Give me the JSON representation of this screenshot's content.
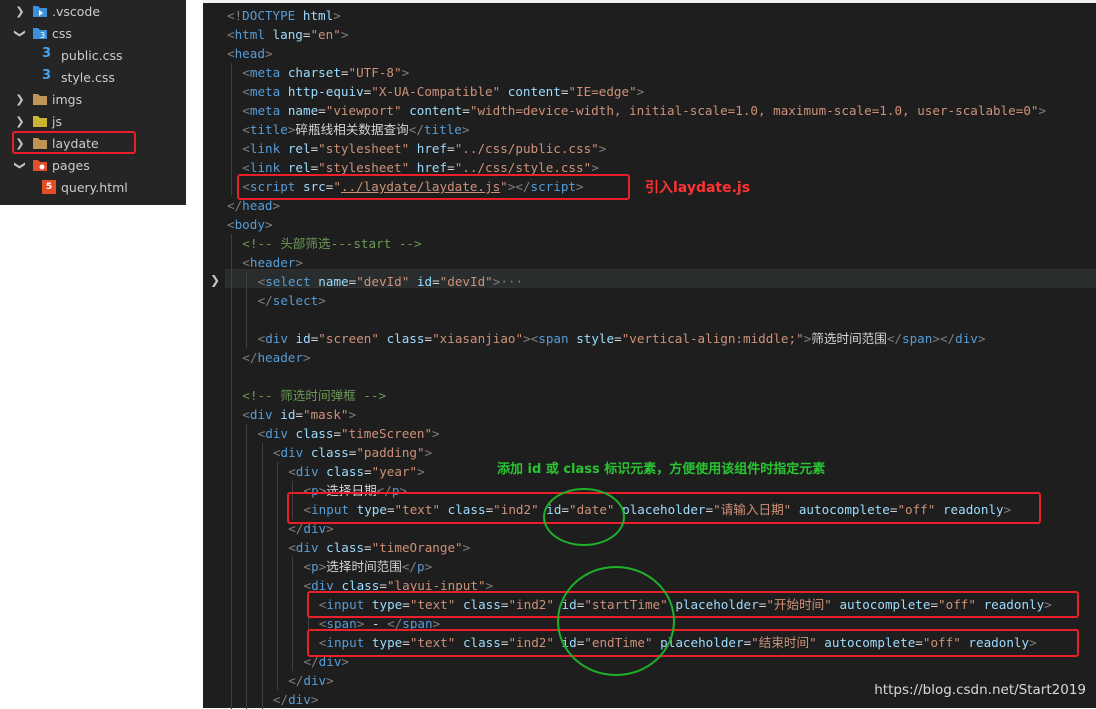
{
  "explorer": {
    "items": [
      {
        "label": ".vscode",
        "expanded": false,
        "icon": "vscode-folder-icon"
      },
      {
        "label": "css",
        "expanded": true,
        "icon": "css-folder-icon"
      },
      {
        "label": "public.css",
        "icon": "css-file-icon"
      },
      {
        "label": "style.css",
        "icon": "css-file-icon"
      },
      {
        "label": "imgs",
        "expanded": false,
        "icon": "folder-icon"
      },
      {
        "label": "js",
        "expanded": false,
        "icon": "js-folder-icon"
      },
      {
        "label": "laydate",
        "expanded": false,
        "icon": "folder-icon",
        "highlighted": true
      },
      {
        "label": "pages",
        "expanded": true,
        "icon": "pages-folder-icon"
      },
      {
        "label": "query.html",
        "icon": "html-file-icon"
      }
    ]
  },
  "code_lines": [
    {
      "indent": 0,
      "tokens": [
        [
          "brk",
          "<!"
        ],
        [
          "tag",
          "DOCTYPE"
        ],
        [
          "txt",
          " "
        ],
        [
          "attr",
          "html"
        ],
        [
          "brk",
          ">"
        ]
      ]
    },
    {
      "indent": 0,
      "tokens": [
        [
          "brk",
          "<"
        ],
        [
          "tag",
          "html"
        ],
        [
          "txt",
          " "
        ],
        [
          "attr",
          "lang"
        ],
        [
          "txt",
          "="
        ],
        [
          "str",
          "\"en\""
        ],
        [
          "brk",
          ">"
        ]
      ]
    },
    {
      "indent": 0,
      "tokens": [
        [
          "brk",
          "<"
        ],
        [
          "tag",
          "head"
        ],
        [
          "brk",
          ">"
        ]
      ]
    },
    {
      "indent": 1,
      "tokens": [
        [
          "brk",
          "<"
        ],
        [
          "tag",
          "meta"
        ],
        [
          "txt",
          " "
        ],
        [
          "attr",
          "charset"
        ],
        [
          "txt",
          "="
        ],
        [
          "str",
          "\"UTF-8\""
        ],
        [
          "brk",
          ">"
        ]
      ]
    },
    {
      "indent": 1,
      "tokens": [
        [
          "brk",
          "<"
        ],
        [
          "tag",
          "meta"
        ],
        [
          "txt",
          " "
        ],
        [
          "attr",
          "http-equiv"
        ],
        [
          "txt",
          "="
        ],
        [
          "str",
          "\"X-UA-Compatible\""
        ],
        [
          "txt",
          " "
        ],
        [
          "attr",
          "content"
        ],
        [
          "txt",
          "="
        ],
        [
          "str",
          "\"IE=edge\""
        ],
        [
          "brk",
          ">"
        ]
      ]
    },
    {
      "indent": 1,
      "tokens": [
        [
          "brk",
          "<"
        ],
        [
          "tag",
          "meta"
        ],
        [
          "txt",
          " "
        ],
        [
          "attr",
          "name"
        ],
        [
          "txt",
          "="
        ],
        [
          "str",
          "\"viewport\""
        ],
        [
          "txt",
          " "
        ],
        [
          "attr",
          "content"
        ],
        [
          "txt",
          "="
        ],
        [
          "str",
          "\"width=device-width, initial-scale=1.0, maximum-scale=1.0, user-scalable=0\""
        ],
        [
          "brk",
          ">"
        ]
      ]
    },
    {
      "indent": 1,
      "tokens": [
        [
          "brk",
          "<"
        ],
        [
          "tag",
          "title"
        ],
        [
          "brk",
          ">"
        ],
        [
          "txt",
          "碎瓶线相关数据查询"
        ],
        [
          "brk",
          "</"
        ],
        [
          "tag",
          "title"
        ],
        [
          "brk",
          ">"
        ]
      ]
    },
    {
      "indent": 1,
      "tokens": [
        [
          "brk",
          "<"
        ],
        [
          "tag",
          "link"
        ],
        [
          "txt",
          " "
        ],
        [
          "attr",
          "rel"
        ],
        [
          "txt",
          "="
        ],
        [
          "str",
          "\"stylesheet\""
        ],
        [
          "txt",
          " "
        ],
        [
          "attr",
          "href"
        ],
        [
          "txt",
          "="
        ],
        [
          "str",
          "\"../css/public.css\""
        ],
        [
          "brk",
          ">"
        ]
      ]
    },
    {
      "indent": 1,
      "tokens": [
        [
          "brk",
          "<"
        ],
        [
          "tag",
          "link"
        ],
        [
          "txt",
          " "
        ],
        [
          "attr",
          "rel"
        ],
        [
          "txt",
          "="
        ],
        [
          "str",
          "\"stylesheet\""
        ],
        [
          "txt",
          " "
        ],
        [
          "attr",
          "href"
        ],
        [
          "txt",
          "="
        ],
        [
          "str",
          "\"../css/style.css\""
        ],
        [
          "brk",
          ">"
        ]
      ]
    },
    {
      "indent": 1,
      "tokens": [
        [
          "brk",
          "<"
        ],
        [
          "tag",
          "script"
        ],
        [
          "txt",
          " "
        ],
        [
          "attr",
          "src"
        ],
        [
          "txt",
          "="
        ],
        [
          "str",
          "\""
        ],
        [
          "link",
          "../laydate/laydate.js"
        ],
        [
          "str",
          "\""
        ],
        [
          "brk",
          "></"
        ],
        [
          "tag",
          "script"
        ],
        [
          "brk",
          ">"
        ]
      ]
    },
    {
      "indent": 0,
      "tokens": [
        [
          "brk",
          "</"
        ],
        [
          "tag",
          "head"
        ],
        [
          "brk",
          ">"
        ]
      ]
    },
    {
      "indent": 0,
      "tokens": [
        [
          "brk",
          "<"
        ],
        [
          "tag",
          "body"
        ],
        [
          "brk",
          ">"
        ]
      ]
    },
    {
      "indent": 1,
      "tokens": [
        [
          "cmt",
          "<!-- 头部筛选---start -->"
        ]
      ]
    },
    {
      "indent": 1,
      "tokens": [
        [
          "brk",
          "<"
        ],
        [
          "tag",
          "header"
        ],
        [
          "brk",
          ">"
        ]
      ]
    },
    {
      "indent": 2,
      "tokens": [
        [
          "brk",
          "<"
        ],
        [
          "tag",
          "select"
        ],
        [
          "txt",
          " "
        ],
        [
          "attr",
          "name"
        ],
        [
          "txt",
          "="
        ],
        [
          "str",
          "\"devId\""
        ],
        [
          "txt",
          " "
        ],
        [
          "attr",
          "id"
        ],
        [
          "txt",
          "="
        ],
        [
          "str",
          "\"devId\""
        ],
        [
          "brk",
          ">"
        ],
        [
          "brk",
          "···"
        ]
      ],
      "folded": true
    },
    {
      "indent": 2,
      "tokens": [
        [
          "brk",
          "</"
        ],
        [
          "tag",
          "select"
        ],
        [
          "brk",
          ">"
        ]
      ]
    },
    {
      "indent": 0,
      "tokens": []
    },
    {
      "indent": 2,
      "tokens": [
        [
          "brk",
          "<"
        ],
        [
          "tag",
          "div"
        ],
        [
          "txt",
          " "
        ],
        [
          "attr",
          "id"
        ],
        [
          "txt",
          "="
        ],
        [
          "str",
          "\"screen\""
        ],
        [
          "txt",
          " "
        ],
        [
          "attr",
          "class"
        ],
        [
          "txt",
          "="
        ],
        [
          "str",
          "\"xiasanjiao\""
        ],
        [
          "brk",
          "><"
        ],
        [
          "tag",
          "span"
        ],
        [
          "txt",
          " "
        ],
        [
          "attr",
          "style"
        ],
        [
          "txt",
          "="
        ],
        [
          "str",
          "\"vertical-align:middle;\""
        ],
        [
          "brk",
          ">"
        ],
        [
          "txt",
          "筛选时间范围"
        ],
        [
          "brk",
          "</"
        ],
        [
          "tag",
          "span"
        ],
        [
          "brk",
          "></"
        ],
        [
          "tag",
          "div"
        ],
        [
          "brk",
          ">"
        ]
      ]
    },
    {
      "indent": 1,
      "tokens": [
        [
          "brk",
          "</"
        ],
        [
          "tag",
          "header"
        ],
        [
          "brk",
          ">"
        ]
      ]
    },
    {
      "indent": 0,
      "tokens": []
    },
    {
      "indent": 1,
      "tokens": [
        [
          "cmt",
          "<!-- 筛选时间弹框 -->"
        ]
      ]
    },
    {
      "indent": 1,
      "tokens": [
        [
          "brk",
          "<"
        ],
        [
          "tag",
          "div"
        ],
        [
          "txt",
          " "
        ],
        [
          "attr",
          "id"
        ],
        [
          "txt",
          "="
        ],
        [
          "str",
          "\"mask\""
        ],
        [
          "brk",
          ">"
        ]
      ]
    },
    {
      "indent": 2,
      "tokens": [
        [
          "brk",
          "<"
        ],
        [
          "tag",
          "div"
        ],
        [
          "txt",
          " "
        ],
        [
          "attr",
          "class"
        ],
        [
          "txt",
          "="
        ],
        [
          "str",
          "\"timeScreen\""
        ],
        [
          "brk",
          ">"
        ]
      ]
    },
    {
      "indent": 3,
      "tokens": [
        [
          "brk",
          "<"
        ],
        [
          "tag",
          "div"
        ],
        [
          "txt",
          " "
        ],
        [
          "attr",
          "class"
        ],
        [
          "txt",
          "="
        ],
        [
          "str",
          "\"padding\""
        ],
        [
          "brk",
          ">"
        ]
      ]
    },
    {
      "indent": 4,
      "tokens": [
        [
          "brk",
          "<"
        ],
        [
          "tag",
          "div"
        ],
        [
          "txt",
          " "
        ],
        [
          "attr",
          "class"
        ],
        [
          "txt",
          "="
        ],
        [
          "str",
          "\"year\""
        ],
        [
          "brk",
          ">"
        ]
      ]
    },
    {
      "indent": 5,
      "tokens": [
        [
          "brk",
          "<"
        ],
        [
          "tag",
          "p"
        ],
        [
          "brk",
          ">"
        ],
        [
          "txt",
          "选择日期"
        ],
        [
          "brk",
          "</"
        ],
        [
          "tag",
          "p"
        ],
        [
          "brk",
          ">"
        ]
      ]
    },
    {
      "indent": 5,
      "tokens": [
        [
          "brk",
          "<"
        ],
        [
          "tag",
          "input"
        ],
        [
          "txt",
          " "
        ],
        [
          "attr",
          "type"
        ],
        [
          "txt",
          "="
        ],
        [
          "str",
          "\"text\""
        ],
        [
          "txt",
          " "
        ],
        [
          "attr",
          "class"
        ],
        [
          "txt",
          "="
        ],
        [
          "str",
          "\"ind2\""
        ],
        [
          "txt",
          " "
        ],
        [
          "attr",
          "id"
        ],
        [
          "txt",
          "="
        ],
        [
          "str",
          "\"date\""
        ],
        [
          "txt",
          " "
        ],
        [
          "attr",
          "placeholder"
        ],
        [
          "txt",
          "="
        ],
        [
          "str",
          "\"请输入日期\""
        ],
        [
          "txt",
          " "
        ],
        [
          "attr",
          "autocomplete"
        ],
        [
          "txt",
          "="
        ],
        [
          "str",
          "\"off\""
        ],
        [
          "txt",
          " "
        ],
        [
          "attr",
          "readonly"
        ],
        [
          "brk",
          ">"
        ]
      ]
    },
    {
      "indent": 4,
      "tokens": [
        [
          "brk",
          "</"
        ],
        [
          "tag",
          "div"
        ],
        [
          "brk",
          ">"
        ]
      ]
    },
    {
      "indent": 4,
      "tokens": [
        [
          "brk",
          "<"
        ],
        [
          "tag",
          "div"
        ],
        [
          "txt",
          " "
        ],
        [
          "attr",
          "class"
        ],
        [
          "txt",
          "="
        ],
        [
          "str",
          "\"timeOrange\""
        ],
        [
          "brk",
          ">"
        ]
      ]
    },
    {
      "indent": 5,
      "tokens": [
        [
          "brk",
          "<"
        ],
        [
          "tag",
          "p"
        ],
        [
          "brk",
          ">"
        ],
        [
          "txt",
          "选择时间范围"
        ],
        [
          "brk",
          "</"
        ],
        [
          "tag",
          "p"
        ],
        [
          "brk",
          ">"
        ]
      ]
    },
    {
      "indent": 5,
      "tokens": [
        [
          "brk",
          "<"
        ],
        [
          "tag",
          "div"
        ],
        [
          "txt",
          " "
        ],
        [
          "attr",
          "class"
        ],
        [
          "txt",
          "="
        ],
        [
          "str",
          "\"layui-input\""
        ],
        [
          "brk",
          ">"
        ]
      ]
    },
    {
      "indent": 6,
      "tokens": [
        [
          "brk",
          "<"
        ],
        [
          "tag",
          "input"
        ],
        [
          "txt",
          " "
        ],
        [
          "attr",
          "type"
        ],
        [
          "txt",
          "="
        ],
        [
          "str",
          "\"text\""
        ],
        [
          "txt",
          " "
        ],
        [
          "attr",
          "class"
        ],
        [
          "txt",
          "="
        ],
        [
          "str",
          "\"ind2\""
        ],
        [
          "txt",
          " "
        ],
        [
          "attr",
          "id"
        ],
        [
          "txt",
          "="
        ],
        [
          "str",
          "\"startTime\""
        ],
        [
          "txt",
          " "
        ],
        [
          "attr",
          "placeholder"
        ],
        [
          "txt",
          "="
        ],
        [
          "str",
          "\"开始时间\""
        ],
        [
          "txt",
          " "
        ],
        [
          "attr",
          "autocomplete"
        ],
        [
          "txt",
          "="
        ],
        [
          "str",
          "\"off\""
        ],
        [
          "txt",
          " "
        ],
        [
          "attr",
          "readonly"
        ],
        [
          "brk",
          ">"
        ]
      ]
    },
    {
      "indent": 6,
      "tokens": [
        [
          "brk",
          "<"
        ],
        [
          "tag",
          "span"
        ],
        [
          "brk",
          ">"
        ],
        [
          "txt",
          " - "
        ],
        [
          "brk",
          "</"
        ],
        [
          "tag",
          "span"
        ],
        [
          "brk",
          ">"
        ]
      ]
    },
    {
      "indent": 6,
      "tokens": [
        [
          "brk",
          "<"
        ],
        [
          "tag",
          "input"
        ],
        [
          "txt",
          " "
        ],
        [
          "attr",
          "type"
        ],
        [
          "txt",
          "="
        ],
        [
          "str",
          "\"text\""
        ],
        [
          "txt",
          " "
        ],
        [
          "attr",
          "class"
        ],
        [
          "txt",
          "="
        ],
        [
          "str",
          "\"ind2\""
        ],
        [
          "txt",
          " "
        ],
        [
          "attr",
          "id"
        ],
        [
          "txt",
          "="
        ],
        [
          "str",
          "\"endTime\""
        ],
        [
          "txt",
          " "
        ],
        [
          "attr",
          "placeholder"
        ],
        [
          "txt",
          "="
        ],
        [
          "str",
          "\"结束时间\""
        ],
        [
          "txt",
          " "
        ],
        [
          "attr",
          "autocomplete"
        ],
        [
          "txt",
          "="
        ],
        [
          "str",
          "\"off\""
        ],
        [
          "txt",
          " "
        ],
        [
          "attr",
          "readonly"
        ],
        [
          "brk",
          ">"
        ]
      ]
    },
    {
      "indent": 5,
      "tokens": [
        [
          "brk",
          "</"
        ],
        [
          "tag",
          "div"
        ],
        [
          "brk",
          ">"
        ]
      ]
    },
    {
      "indent": 4,
      "tokens": [
        [
          "brk",
          "</"
        ],
        [
          "tag",
          "div"
        ],
        [
          "brk",
          ">"
        ]
      ]
    },
    {
      "indent": 3,
      "tokens": [
        [
          "brk",
          "</"
        ],
        [
          "tag",
          "div"
        ],
        [
          "brk",
          ">"
        ]
      ]
    }
  ],
  "annotations": {
    "include_note": "引入laydate.js",
    "id_note": "添加 id 或 class 标识元素，方便使用该组件时指定元素"
  },
  "watermark": "https://blog.csdn.net/Start2019",
  "colors": {
    "editor_bg": "#1e1e1e",
    "sidebar_bg": "#252526",
    "tag": "#569cd6",
    "attr": "#9cdcfe",
    "string": "#ce9178",
    "comment": "#6a9955",
    "annotation_red": "#e8202a",
    "annotation_green": "#1fb02a"
  }
}
